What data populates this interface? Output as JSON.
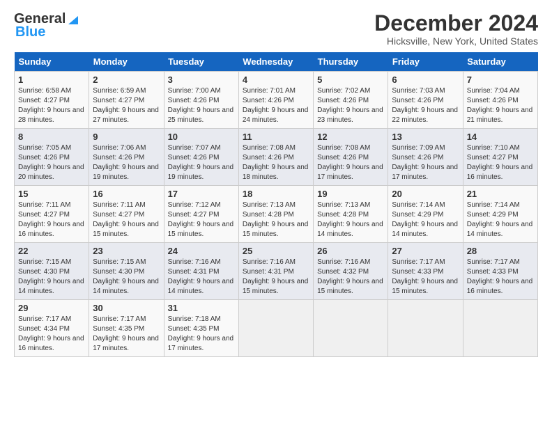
{
  "header": {
    "logo_line1": "General",
    "logo_line2": "Blue",
    "title": "December 2024",
    "location": "Hicksville, New York, United States"
  },
  "days_of_week": [
    "Sunday",
    "Monday",
    "Tuesday",
    "Wednesday",
    "Thursday",
    "Friday",
    "Saturday"
  ],
  "weeks": [
    [
      {
        "day": "1",
        "sunrise": "6:58 AM",
        "sunset": "4:27 PM",
        "daylight": "9 hours and 28 minutes."
      },
      {
        "day": "2",
        "sunrise": "6:59 AM",
        "sunset": "4:27 PM",
        "daylight": "9 hours and 27 minutes."
      },
      {
        "day": "3",
        "sunrise": "7:00 AM",
        "sunset": "4:26 PM",
        "daylight": "9 hours and 25 minutes."
      },
      {
        "day": "4",
        "sunrise": "7:01 AM",
        "sunset": "4:26 PM",
        "daylight": "9 hours and 24 minutes."
      },
      {
        "day": "5",
        "sunrise": "7:02 AM",
        "sunset": "4:26 PM",
        "daylight": "9 hours and 23 minutes."
      },
      {
        "day": "6",
        "sunrise": "7:03 AM",
        "sunset": "4:26 PM",
        "daylight": "9 hours and 22 minutes."
      },
      {
        "day": "7",
        "sunrise": "7:04 AM",
        "sunset": "4:26 PM",
        "daylight": "9 hours and 21 minutes."
      }
    ],
    [
      {
        "day": "8",
        "sunrise": "7:05 AM",
        "sunset": "4:26 PM",
        "daylight": "9 hours and 20 minutes."
      },
      {
        "day": "9",
        "sunrise": "7:06 AM",
        "sunset": "4:26 PM",
        "daylight": "9 hours and 19 minutes."
      },
      {
        "day": "10",
        "sunrise": "7:07 AM",
        "sunset": "4:26 PM",
        "daylight": "9 hours and 19 minutes."
      },
      {
        "day": "11",
        "sunrise": "7:08 AM",
        "sunset": "4:26 PM",
        "daylight": "9 hours and 18 minutes."
      },
      {
        "day": "12",
        "sunrise": "7:08 AM",
        "sunset": "4:26 PM",
        "daylight": "9 hours and 17 minutes."
      },
      {
        "day": "13",
        "sunrise": "7:09 AM",
        "sunset": "4:26 PM",
        "daylight": "9 hours and 17 minutes."
      },
      {
        "day": "14",
        "sunrise": "7:10 AM",
        "sunset": "4:27 PM",
        "daylight": "9 hours and 16 minutes."
      }
    ],
    [
      {
        "day": "15",
        "sunrise": "7:11 AM",
        "sunset": "4:27 PM",
        "daylight": "9 hours and 16 minutes."
      },
      {
        "day": "16",
        "sunrise": "7:11 AM",
        "sunset": "4:27 PM",
        "daylight": "9 hours and 15 minutes."
      },
      {
        "day": "17",
        "sunrise": "7:12 AM",
        "sunset": "4:27 PM",
        "daylight": "9 hours and 15 minutes."
      },
      {
        "day": "18",
        "sunrise": "7:13 AM",
        "sunset": "4:28 PM",
        "daylight": "9 hours and 15 minutes."
      },
      {
        "day": "19",
        "sunrise": "7:13 AM",
        "sunset": "4:28 PM",
        "daylight": "9 hours and 14 minutes."
      },
      {
        "day": "20",
        "sunrise": "7:14 AM",
        "sunset": "4:29 PM",
        "daylight": "9 hours and 14 minutes."
      },
      {
        "day": "21",
        "sunrise": "7:14 AM",
        "sunset": "4:29 PM",
        "daylight": "9 hours and 14 minutes."
      }
    ],
    [
      {
        "day": "22",
        "sunrise": "7:15 AM",
        "sunset": "4:30 PM",
        "daylight": "9 hours and 14 minutes."
      },
      {
        "day": "23",
        "sunrise": "7:15 AM",
        "sunset": "4:30 PM",
        "daylight": "9 hours and 14 minutes."
      },
      {
        "day": "24",
        "sunrise": "7:16 AM",
        "sunset": "4:31 PM",
        "daylight": "9 hours and 14 minutes."
      },
      {
        "day": "25",
        "sunrise": "7:16 AM",
        "sunset": "4:31 PM",
        "daylight": "9 hours and 15 minutes."
      },
      {
        "day": "26",
        "sunrise": "7:16 AM",
        "sunset": "4:32 PM",
        "daylight": "9 hours and 15 minutes."
      },
      {
        "day": "27",
        "sunrise": "7:17 AM",
        "sunset": "4:33 PM",
        "daylight": "9 hours and 15 minutes."
      },
      {
        "day": "28",
        "sunrise": "7:17 AM",
        "sunset": "4:33 PM",
        "daylight": "9 hours and 16 minutes."
      }
    ],
    [
      {
        "day": "29",
        "sunrise": "7:17 AM",
        "sunset": "4:34 PM",
        "daylight": "9 hours and 16 minutes."
      },
      {
        "day": "30",
        "sunrise": "7:17 AM",
        "sunset": "4:35 PM",
        "daylight": "9 hours and 17 minutes."
      },
      {
        "day": "31",
        "sunrise": "7:18 AM",
        "sunset": "4:35 PM",
        "daylight": "9 hours and 17 minutes."
      },
      null,
      null,
      null,
      null
    ]
  ]
}
